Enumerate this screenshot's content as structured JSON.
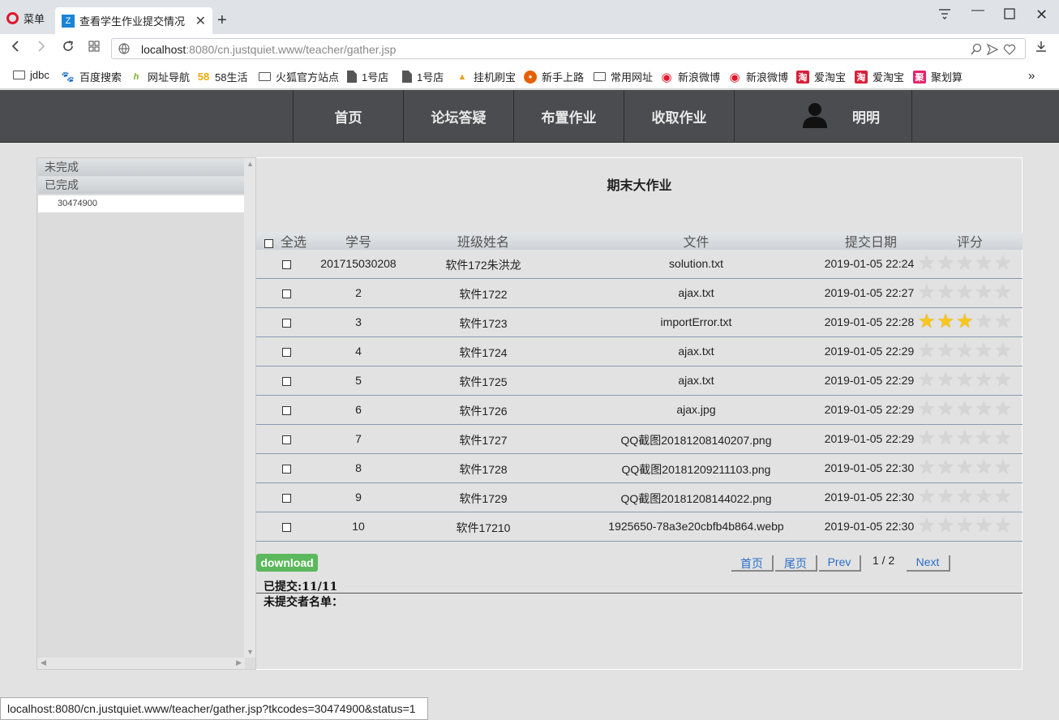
{
  "browser": {
    "menu_label": "菜单",
    "tab_title": "查看学生作业提交情况",
    "url_host": "localhost",
    "url_rest": ":8080/cn.justquiet.www/teacher/gather.jsp",
    "bookmarks": [
      {
        "label": "jdbc",
        "icon": "folder-icon"
      },
      {
        "label": "百度搜索",
        "icon": "baidu-icon"
      },
      {
        "label": "网址导航",
        "icon": "hao-icon"
      },
      {
        "label": "58生活",
        "icon": "58-icon"
      },
      {
        "label": "火狐官方站点",
        "icon": "folder-icon"
      },
      {
        "label": "1号店",
        "icon": "document-icon"
      },
      {
        "label": "1号店",
        "icon": "document-icon"
      },
      {
        "label": "挂机刷宝",
        "icon": "pma-icon"
      },
      {
        "label": "新手上路",
        "icon": "firefox-icon"
      },
      {
        "label": "常用网址",
        "icon": "folder-icon"
      },
      {
        "label": "新浪微博",
        "icon": "weibo-icon"
      },
      {
        "label": "新浪微博",
        "icon": "weibo-icon"
      },
      {
        "label": "爱淘宝",
        "icon": "taobao-icon"
      },
      {
        "label": "爱淘宝",
        "icon": "taobao-icon"
      },
      {
        "label": "聚划算",
        "icon": "juhuasuan-icon"
      }
    ],
    "status_url": "localhost:8080/cn.justquiet.www/teacher/gather.jsp?tkcodes=30474900&status=1"
  },
  "nav": {
    "items": [
      "首页",
      "论坛答疑",
      "布置作业",
      "收取作业"
    ],
    "user_name": "明明"
  },
  "sidebar": {
    "incomplete_label": "未完成",
    "complete_label": "已完成",
    "sub_item": "30474900"
  },
  "main": {
    "title": "期末大作业",
    "headers": {
      "select_all": "全选",
      "student_id": "学号",
      "class_name": "班级姓名",
      "file": "文件",
      "date": "提交日期",
      "score": "评分"
    },
    "rows": [
      {
        "id": "201715030208",
        "name": "软件172朱洪龙",
        "file": "solution.txt",
        "date": "2019-01-05 22:24",
        "rating": 0
      },
      {
        "id": "2",
        "name": "软件1722",
        "file": "ajax.txt",
        "date": "2019-01-05 22:27",
        "rating": 0
      },
      {
        "id": "3",
        "name": "软件1723",
        "file": "importError.txt",
        "date": "2019-01-05 22:28",
        "rating": 3
      },
      {
        "id": "4",
        "name": "软件1724",
        "file": "ajax.txt",
        "date": "2019-01-05 22:29",
        "rating": 0
      },
      {
        "id": "5",
        "name": "软件1725",
        "file": "ajax.txt",
        "date": "2019-01-05 22:29",
        "rating": 0
      },
      {
        "id": "6",
        "name": "软件1726",
        "file": "ajax.jpg",
        "date": "2019-01-05 22:29",
        "rating": 0
      },
      {
        "id": "7",
        "name": "软件1727",
        "file": "QQ截图20181208140207.png",
        "date": "2019-01-05 22:29",
        "rating": 0
      },
      {
        "id": "8",
        "name": "软件1728",
        "file": "QQ截图20181209211103.png",
        "date": "2019-01-05 22:30",
        "rating": 0
      },
      {
        "id": "9",
        "name": "软件1729",
        "file": "QQ截图20181208144022.png",
        "date": "2019-01-05 22:30",
        "rating": 0
      },
      {
        "id": "10",
        "name": "软件17210",
        "file": "1925650-78a3e20cbfb4b864.webp",
        "date": "2019-01-05 22:30",
        "rating": 0
      }
    ],
    "download_label": "download",
    "pager": {
      "first": "首页",
      "last": "尾页",
      "prev": "Prev",
      "info": "1 / 2",
      "next": "Next"
    },
    "submitted": "已提交:11/11",
    "not_submitted": "未提交者名单："
  },
  "colors": {
    "header_bg": "#4a4c4f",
    "download_green": "#5cb85c",
    "star_on": "#f7c71b",
    "star_off": "#d5d5d5",
    "link_blue": "#2a6fc9"
  }
}
